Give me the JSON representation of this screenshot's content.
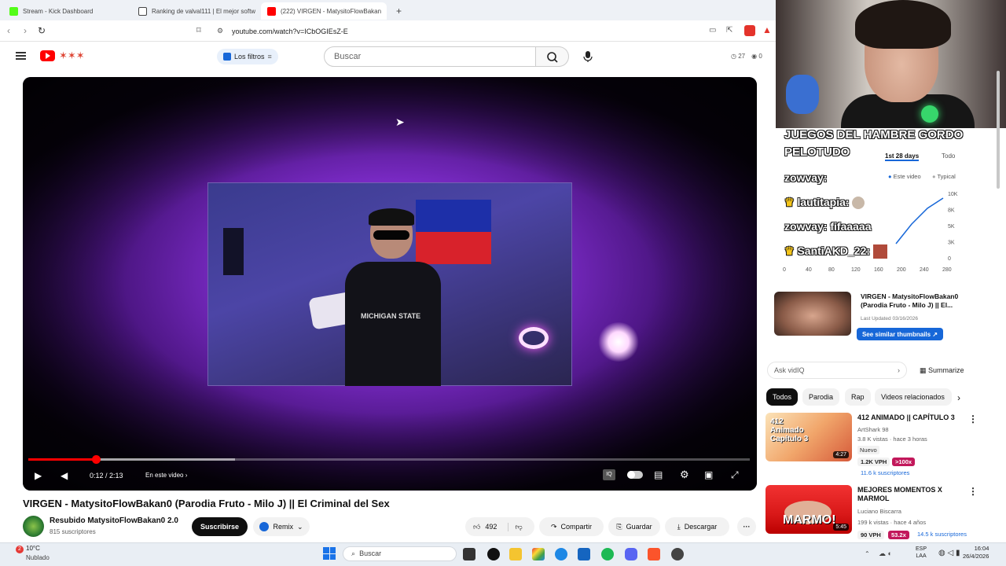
{
  "browser": {
    "tabs": [
      {
        "title": "Stream - Kick Dashboard",
        "fav_color": "#53fc18"
      },
      {
        "title": "Ranking de valval111 | El mejor softw",
        "fav_color": "#444444"
      },
      {
        "title": "(222) VIRGEN - MatysitoFlowBakan",
        "fav_color": "#ff0000"
      }
    ],
    "new_tab": "+",
    "url": "youtube.com/watch?v=ICbOGIEsZ-E"
  },
  "youtube": {
    "filters_label": "Los filtros",
    "search_placeholder": "Buscar",
    "stats": {
      "views": "27",
      "eye": "0"
    }
  },
  "video": {
    "time": "0:12 / 2:13",
    "chapter": "En este video",
    "progress": 0.094,
    "title": "VIRGEN - MatysitoFlowBakan0 (Parodia Fruto - Milo J) || El Criminal del Sex",
    "channel": "Resubido MatysitoFlowBakan0 2.0",
    "subscribers": "815 suscriptores",
    "subscribe_label": "Suscribirse",
    "remix_label": "Remix",
    "likes": "492",
    "share_label": "Compartir",
    "save_label": "Guardar",
    "download_label": "Descargar",
    "more": "···"
  },
  "overlay": {
    "banner_line1": "JUEGOS DEL HAMBRE GORDO",
    "banner_line2": "PELOTUDO",
    "chat": [
      {
        "user": "zowvay:",
        "text": ""
      },
      {
        "user": "lautitapia:",
        "text": ""
      },
      {
        "user": "zowvay:",
        "text": "fifaaaaa"
      },
      {
        "user": "SantiAKD_22:",
        "text": ""
      }
    ]
  },
  "vidiq": {
    "range_tabs": [
      "1st 28 days",
      "Todo"
    ],
    "legend": [
      "Este video",
      "Typical"
    ],
    "y_ticks": [
      "10K",
      "8K",
      "5K",
      "3K",
      "0"
    ],
    "x_ticks": [
      "0",
      "40",
      "80",
      "120",
      "160",
      "200",
      "240",
      "280"
    ],
    "card_title": "VIRGEN - MatysitoFlowBakan0 (Parodia Fruto - Milo J) || El...",
    "last_updated": "Last Updated 03/16/2026",
    "similar_button": "See similar thumbnails",
    "ask_placeholder": "Ask vidIQ",
    "summarize": "Summarize"
  },
  "chips": [
    "Todos",
    "Parodia",
    "Rap",
    "Videos relacionados"
  ],
  "recommendations": [
    {
      "title": "412 ANIMADO || CAPÍTULO 3",
      "channel": "ArtShark 98",
      "meta": "3.8 K vistas · hace 3 horas",
      "badge": "Nuevo",
      "vph": "1.2K VPH",
      "mult": ">100x",
      "subs": "11.6 k suscriptores",
      "duration": "4:27",
      "thumb_text": "412 Animado Capítulo 3"
    },
    {
      "title": "MEJORES MOMENTOS X MARMOL",
      "channel": "Luciano Biscarra",
      "meta": "199 k vistas · hace 4 años",
      "vph": "90 VPH",
      "mult": "53.2x",
      "subs": "14.5 k suscriptores",
      "duration": "5:45",
      "thumb_text": "MARMO!"
    }
  ],
  "taskbar": {
    "weather_temp": "10°C",
    "weather_desc": "Nublado",
    "search": "Buscar",
    "lang1": "ESP",
    "lang2": "LAA",
    "time": "16:04",
    "date": "26/4/2026"
  }
}
